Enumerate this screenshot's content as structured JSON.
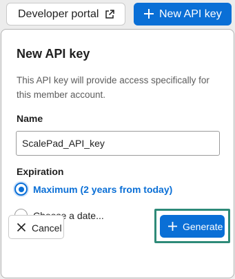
{
  "header": {
    "developer_portal_label": "Developer portal",
    "new_api_key_label": "New API key"
  },
  "dialog": {
    "title": "New API key",
    "description": "This API key will provide access specifically for this member account.",
    "name_label": "Name",
    "name_value": "ScalePad_API_key",
    "expiration_label": "Expiration",
    "options": [
      {
        "label": "Maximum (2 years from today)",
        "selected": true
      },
      {
        "label": "Choose a date...",
        "selected": false
      }
    ],
    "cancel_label": "Cancel",
    "generate_label": "Generate"
  },
  "colors": {
    "accent": "#0a6fd6",
    "highlight_frame": "#2e8a78"
  },
  "icons": {
    "external_link": "external-link-icon",
    "plus": "plus-icon",
    "close": "close-icon"
  }
}
